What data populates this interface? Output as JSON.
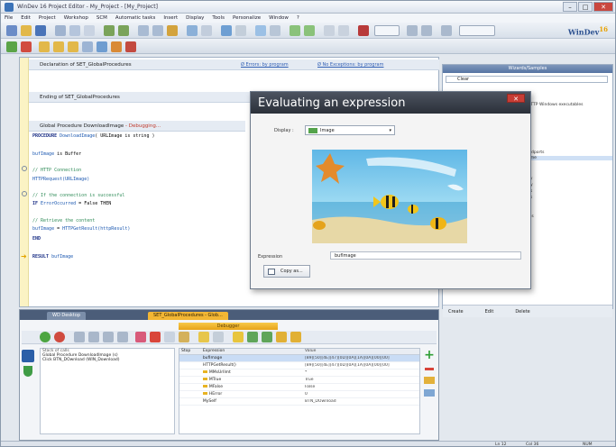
{
  "window": {
    "title": "WinDev 16 Project Editor - My_Project - [My_Project]"
  },
  "menu": [
    "File",
    "Edit",
    "Project",
    "Workshop",
    "SCM",
    "Automatic tasks",
    "Insert",
    "Display",
    "Tools",
    "Personalize",
    "Window",
    "?"
  ],
  "logo": {
    "text": "WinDev",
    "version": "16"
  },
  "editor": {
    "band1": {
      "label": "Declaration of SET_GlobalProcedures",
      "links": [
        "Ø Errors: by program",
        "Ø No Exceptions: by program"
      ]
    },
    "band2": {
      "label": "Ending of SET_GlobalProcedures"
    },
    "band3": {
      "label": "Global Procedure DownloadImage",
      "suffix": "- Debugging..."
    },
    "code": [
      {
        "parts": [
          {
            "t": "PROCEDURE ",
            "c": "kw"
          },
          {
            "t": "DownloadImage",
            "c": "fn"
          },
          {
            "t": "( URLImage is string )",
            "c": "pr"
          }
        ]
      },
      {
        "parts": [
          {
            "t": "",
            "c": "pr"
          }
        ]
      },
      {
        "parts": [
          {
            "t": "bufImage",
            "c": "fn"
          },
          {
            "t": " is Buffer",
            "c": "pr"
          }
        ]
      },
      {
        "parts": [
          {
            "t": "",
            "c": "pr"
          }
        ]
      },
      {
        "parts": [
          {
            "t": "// HTTP Connection",
            "c": "cm"
          }
        ]
      },
      {
        "parts": [
          {
            "t": "HTTPRequest(URLImage)",
            "c": "fn"
          }
        ]
      },
      {
        "parts": [
          {
            "t": "",
            "c": "pr"
          }
        ]
      },
      {
        "parts": [
          {
            "t": "// If the connection is successful",
            "c": "cm"
          }
        ]
      },
      {
        "parts": [
          {
            "t": "IF ",
            "c": "kw"
          },
          {
            "t": "ErrorOccurred",
            "c": "fn"
          },
          {
            "t": " = False THEN",
            "c": "pr"
          }
        ]
      },
      {
        "parts": [
          {
            "t": "",
            "c": "pr"
          }
        ]
      },
      {
        "parts": [
          {
            "t": "    // Retrieve the content",
            "c": "cm"
          }
        ]
      },
      {
        "parts": [
          {
            "t": "    bufImage",
            "c": "fn"
          },
          {
            "t": " = ",
            "c": "pr"
          },
          {
            "t": "HTTPGetResult(httpResult)",
            "c": "fn"
          }
        ]
      },
      {
        "parts": [
          {
            "t": "END",
            "c": "kw"
          }
        ]
      },
      {
        "parts": [
          {
            "t": "",
            "c": "pr"
          }
        ]
      },
      {
        "parts": [
          {
            "t": "RESULT ",
            "c": "kw"
          },
          {
            "t": "bufImage",
            "c": "fn"
          }
        ]
      }
    ]
  },
  "rightpanel": {
    "header": "Wizards/Samples",
    "search_value": "Clear",
    "list": [
      "HTTP Windows executables",
      "",
      "",
      "",
      "",
      "",
      "iodports",
      "ame",
      "",
      "",
      "ay",
      "ity",
      "ds",
      "ds",
      "ia",
      "ls",
      "ms"
    ],
    "buttons": [
      "Create",
      "Edit",
      "Delete"
    ]
  },
  "dialog": {
    "title": "Evaluating an expression",
    "display_label": "Display :",
    "display_value": "Image",
    "expression_label": "Expression",
    "expression_value": "bufImage",
    "copy_button": "Copy as..."
  },
  "debug": {
    "tabs": [
      "WD Desktop",
      "SET_GlobalProcedures - Glob..."
    ],
    "title": "Debugger",
    "stack_header": "Stack of calls",
    "stack": [
      "Global Procedure DownloadImage (s)",
      "Click BTN_DOwnload (WIN_Download)"
    ],
    "columns": [
      "Stop",
      "Expression",
      "",
      "Value"
    ],
    "rows": [
      {
        "expr": "bufImage",
        "val": "[89][50][4E][47][0D][0A][1A][0A][00][00]",
        "sel": true
      },
      {
        "expr": "HTTPGetResult()",
        "val": "[89][50][4E][47][0D][0A][1A][0A][00][00]",
        "sel": false
      },
      {
        "expr": "MMsUrlImt",
        "val": "*",
        "sel": false
      },
      {
        "expr": "MTrue",
        "val": "True",
        "sel": false
      },
      {
        "expr": "MFalse",
        "val": "False",
        "sel": false
      },
      {
        "expr": "HError",
        "val": "0",
        "sel": false
      },
      {
        "expr": "MySelf",
        "val": "BTN_DOwnload",
        "sel": false
      }
    ]
  },
  "status": {
    "line": "Ln 12",
    "col": "Col 36",
    "mode": "NUM"
  }
}
